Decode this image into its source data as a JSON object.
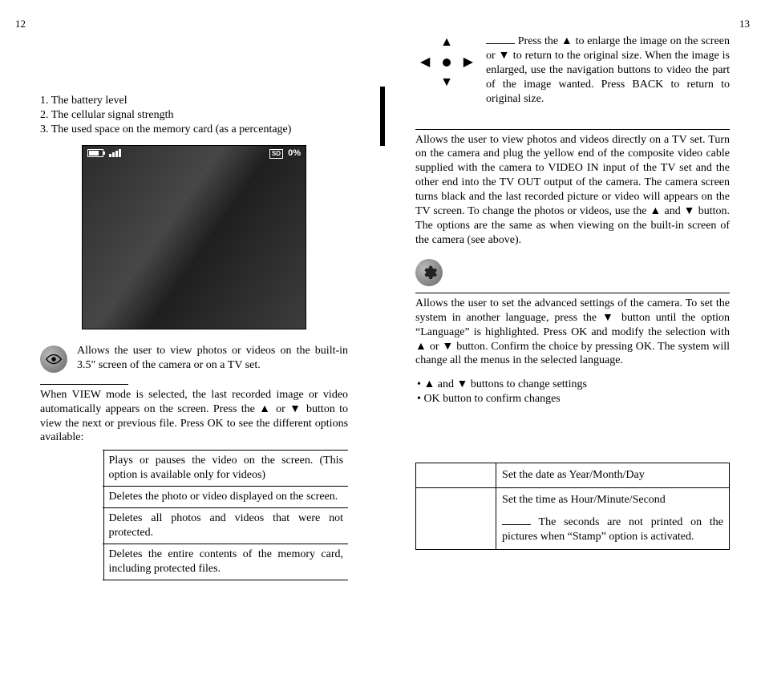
{
  "pageLeftNum": "12",
  "pageRightNum": "13",
  "left": {
    "list": {
      "i1": "1. The battery level",
      "i2": "2. The cellular signal strength",
      "i3": "3. The used space on the memory card (as a percentage)"
    },
    "screenshot": {
      "percent": "0%"
    },
    "eyePara": "Allows the user to view photos or videos on the built-in 3.5\" screen of the camera or on a TV set.",
    "viewPara": "When VIEW mode is selected, the last recorded image or video automatically appears on the screen. Press the ▲ or ▼ button to view the next or previous file. Press OK to see the different options available:",
    "opts": {
      "r1": "Plays or pauses the video on the screen. (This option is available only for videos)",
      "r2": "Deletes the photo or video displayed on the screen.",
      "r3": "Deletes all photos and videos that were not protected.",
      "r4": "Deletes the entire contents of the memory card, including protected files."
    }
  },
  "right": {
    "dpadPara_pre": " Press the ▲ to enlarge the image on the screen or ▼ to return to the original size. When the image is enlarged, use the navigation buttons to video the part of the image wanted. Press BACK to return to original size.",
    "tvPara": "Allows the user to view photos and videos directly on a TV set. Turn on the camera and plug the yellow end of the composite video cable supplied with the camera to VIDEO IN input of the TV set and the other end into the TV OUT output of the camera. The camera screen turns black and the last recorded picture or video will appears on the TV screen. To change the photos or videos, use the ▲ and ▼ button. The options are the same as when viewing on the built-in screen of the camera (see above).",
    "gearPara": "Allows the user to set the advanced settings of the camera. To set the system in another language, press the ▼ button until the option “Language” is highlighted. Press OK and modify the selection with ▲ or ▼ button. Confirm the choice by pressing OK. The system will change all the menus in the selected language.",
    "bullets": {
      "b1": "▲ and ▼ buttons to change settings",
      "b2": "OK button to confirm changes"
    },
    "settings": {
      "r1c2": "Set the date as Year/Month/Day",
      "r2c2a": "Set the time as Hour/Minute/Second",
      "r2c2b": " The seconds are not printed on the pictures when “Stamp” option is activated."
    }
  }
}
